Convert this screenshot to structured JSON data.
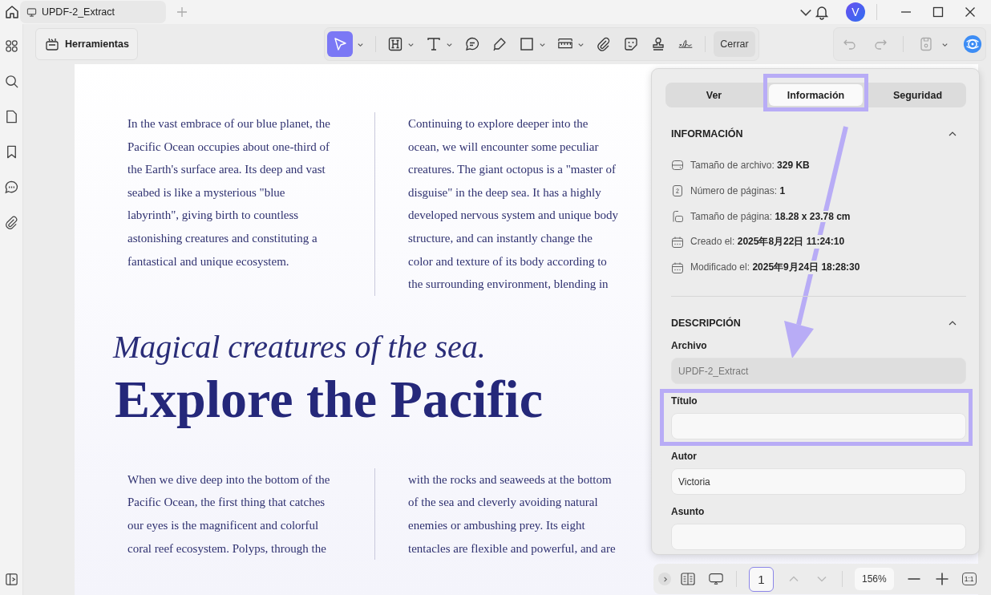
{
  "tab": {
    "title": "UPDF-2_Extract"
  },
  "user": {
    "initial": "V"
  },
  "toolbar": {
    "tools_button": "Herramientas",
    "close_button": "Cerrar"
  },
  "document": {
    "top_columns": [
      [
        "In the vast embrace of our blue planet, the",
        "Pacific Ocean occupies about one-third of",
        "the Earth's surface area. Its deep and vast",
        "seabed is like a mysterious \"blue",
        "labyrinth\", giving birth to countless",
        "astonishing creatures and constituting a",
        "fantastical and unique ecosystem."
      ],
      [
        "Continuing to explore deeper into the",
        "ocean, we will encounter some peculiar",
        "creatures. The giant octopus is a \"master of",
        "disguise\" in the deep sea. It has a highly",
        "developed nervous system and unique body",
        "structure, and can instantly change the",
        "color and texture of its body according to",
        "the surrounding environment, blending in"
      ]
    ],
    "subtitle": "Magical creatures of the sea.",
    "title": "Explore the Pacific",
    "bottom_columns": [
      [
        "When we dive deep into the bottom of the",
        "Pacific Ocean, the first thing that catches",
        "our eyes is the magnificent and colorful",
        "coral reef ecosystem. Polyps, through the"
      ],
      [
        "with the rocks and seaweeds at the bottom",
        "of the sea and cleverly avoiding natural",
        "enemies or ambushing prey. Its eight",
        "tentacles are flexible and powerful, and are"
      ]
    ]
  },
  "panel": {
    "tabs": [
      {
        "label": "Ver",
        "selected": false,
        "highlighted": false
      },
      {
        "label": "Información",
        "selected": true,
        "highlighted": true
      },
      {
        "label": "Seguridad",
        "selected": false,
        "highlighted": false
      }
    ],
    "info": {
      "heading": "INFORMACIÓN",
      "expanded": true,
      "items": [
        {
          "kind": "drive",
          "label": "Tamaño de archivo:",
          "value": "329 KB"
        },
        {
          "kind": "pages",
          "label": "Número de páginas:",
          "value": "1"
        },
        {
          "kind": "page",
          "label": "Tamaño de página:",
          "value": "18.28 x 23.78 cm"
        },
        {
          "kind": "calendar",
          "label": "Creado el:",
          "value": "2025年8月22日 11:24:10"
        },
        {
          "kind": "calendar",
          "label": "Modificado el:",
          "value": "2025年9月24日 18:28:30"
        }
      ]
    },
    "description": {
      "heading": "DESCRIPCIÓN",
      "expanded": true,
      "fields": [
        {
          "label": "Archivo",
          "value": "UPDF-2_Extract",
          "disabled": true,
          "highlighted": false
        },
        {
          "label": "Título",
          "disabled": false,
          "highlighted": true
        },
        {
          "label": "Autor",
          "value": "Victoria",
          "disabled": false,
          "highlighted": false
        },
        {
          "label": "Asunto",
          "disabled": false,
          "highlighted": false
        }
      ]
    }
  },
  "page_bar": {
    "page": "1",
    "zoom": "156%",
    "actual_size": "1:1"
  }
}
